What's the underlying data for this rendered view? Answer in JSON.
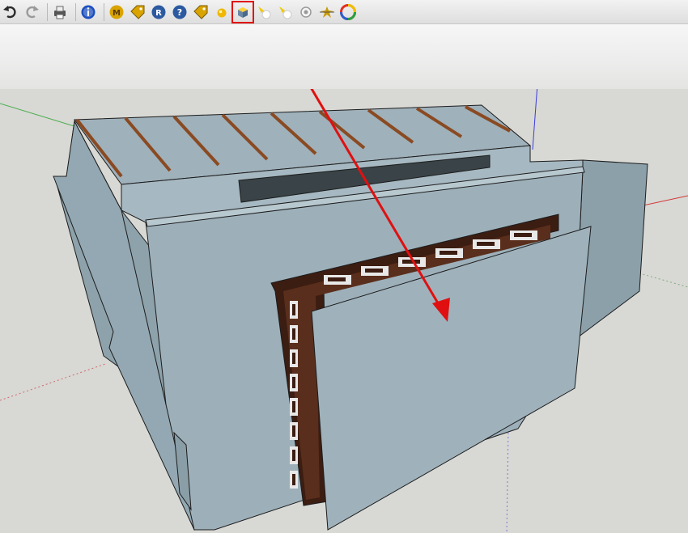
{
  "toolbar": {
    "buttons": [
      {
        "name": "undo-button",
        "icon": "undo-arrow-icon",
        "color": "#2a2a2a"
      },
      {
        "name": "redo-button",
        "icon": "redo-arrow-icon",
        "color": "#9a9a9a"
      },
      {
        "name": "print-button",
        "icon": "printer-icon",
        "color": "#555555"
      },
      {
        "name": "model-info-button",
        "icon": "info-icon",
        "color": "#1d4fbf"
      },
      {
        "name": "materials-button",
        "icon": "material-m-icon",
        "color": "#d9a400"
      },
      {
        "name": "texture-tag-button",
        "icon": "tag-icon",
        "color": "#d9a400"
      },
      {
        "name": "render-r-button",
        "icon": "render-r-icon",
        "color": "#2c5aa0"
      },
      {
        "name": "help-button",
        "icon": "help-icon",
        "color": "#2c5aa0"
      },
      {
        "name": "light-tag-button",
        "icon": "tag-icon",
        "color": "#d9a400"
      },
      {
        "name": "sphere-light-button",
        "icon": "sphere-light-icon",
        "color": "#f0b800"
      },
      {
        "name": "box-light-button",
        "icon": "box-light-icon",
        "color": "#6b87a8"
      },
      {
        "name": "spot-light-button",
        "icon": "spot-light-icon",
        "color": "#f0c800"
      },
      {
        "name": "spot-light-2-button",
        "icon": "spot-light-icon",
        "color": "#f0c800"
      },
      {
        "name": "omni-light-button",
        "icon": "omni-light-icon",
        "color": "#9a9a9a"
      },
      {
        "name": "sun-light-button",
        "icon": "sun-star-icon",
        "color": "#c89a00"
      },
      {
        "name": "color-wheel-button",
        "icon": "color-wheel-icon",
        "color": "#e03020"
      }
    ],
    "highlighted_index": 10
  },
  "scene": {
    "wall_color": "#9db0ba",
    "roof_beam_color": "#8a4a22",
    "frame_color": "#4b2416",
    "background_color": "#d8d8d4",
    "annotation_color": "#e01010"
  }
}
